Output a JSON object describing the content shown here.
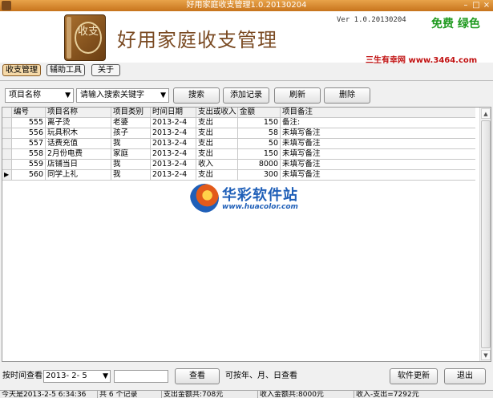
{
  "window": {
    "title": "好用家庭收支管理1.0.20130204"
  },
  "header": {
    "logo_text": "收支",
    "app_name": "好用家庭收支管理",
    "version": "Ver 1.0.20130204",
    "free_badge": "免费 绿色",
    "site": "三生有幸网 www.3464.com"
  },
  "tabs": [
    {
      "label": "收支管理",
      "active": true
    },
    {
      "label": "辅助工具",
      "active": false
    },
    {
      "label": "关于",
      "active": false
    }
  ],
  "search": {
    "field_select": "项目名称",
    "keyword_select": "请输入搜索关键字",
    "search_label": "搜索",
    "add_label": "添加记录",
    "refresh_label": "刷新",
    "delete_label": "删除"
  },
  "table": {
    "columns": [
      "编号",
      "项目名称",
      "项目类别",
      "时间日期",
      "支出或收入",
      "金额",
      "项目备注"
    ],
    "rows": [
      {
        "id": "555",
        "name": "离子烫",
        "category": "老婆",
        "date": "2013-2-4",
        "type": "支出",
        "amount": "150",
        "note": "备注:"
      },
      {
        "id": "556",
        "name": "玩具积木",
        "category": "孩子",
        "date": "2013-2-4",
        "type": "支出",
        "amount": "58",
        "note": "未填写备注"
      },
      {
        "id": "557",
        "name": "话费充值",
        "category": "我",
        "date": "2013-2-4",
        "type": "支出",
        "amount": "50",
        "note": "未填写备注"
      },
      {
        "id": "558",
        "name": "2月份电费",
        "category": "家庭",
        "date": "2013-2-4",
        "type": "支出",
        "amount": "150",
        "note": "未填写备注"
      },
      {
        "id": "559",
        "name": "店铺当日",
        "category": "我",
        "date": "2013-2-4",
        "type": "收入",
        "amount": "8000",
        "note": "未填写备注"
      },
      {
        "id": "560",
        "name": "同学上礼",
        "category": "我",
        "date": "2013-2-4",
        "type": "支出",
        "amount": "300",
        "note": "未填写备注"
      }
    ],
    "current_row_marker": "▶"
  },
  "watermark": {
    "name": "华彩软件站",
    "url": "www.huacolor.com"
  },
  "bottom": {
    "time_query_label": "按时间查看",
    "date_value": "2013- 2- 5",
    "query_label": "查看",
    "hint": "可按年、月、日查看",
    "update_label": "软件更新",
    "exit_label": "退出"
  },
  "status": {
    "today": "今天是2013-2-5 6:34:36",
    "record_count": "共 6 个记录",
    "expense_total": "支出金额共:708元",
    "income_total": "收入金额共:8000元",
    "balance": "收入-支出=7292元"
  },
  "icons": {
    "dropdown": "chevron-down-icon",
    "row_pointer": "row-pointer-icon",
    "minimize": "minimize-icon",
    "maximize": "maximize-icon",
    "close": "close-icon"
  },
  "colors": {
    "title_bar": "#d0822a",
    "app_name": "#7a4a22",
    "free_badge": "#1e9a1e",
    "site": "#c01010",
    "active_tab": "#f5d9a8",
    "watermark": "#1f5fb8"
  }
}
